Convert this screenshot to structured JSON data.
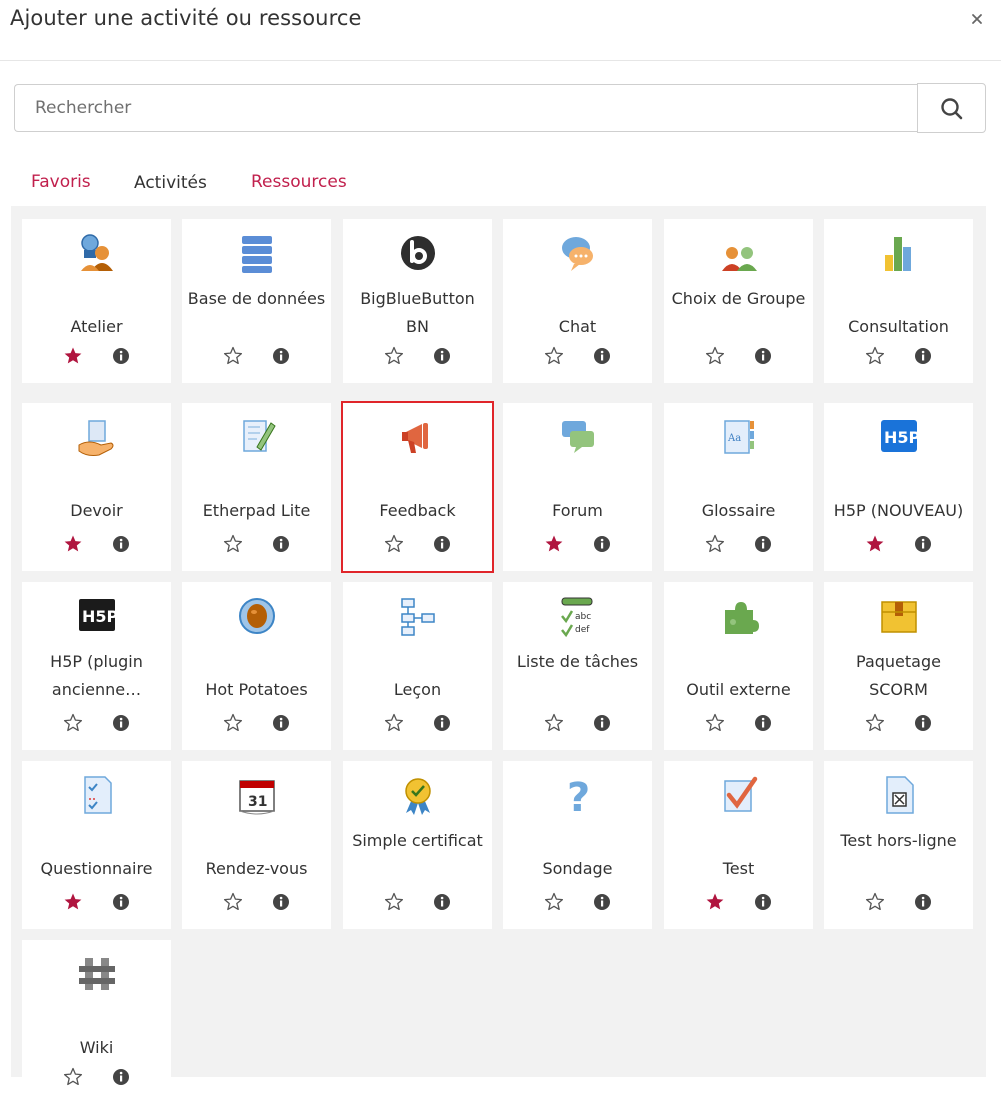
{
  "header": {
    "title": "Ajouter une activité ou ressource",
    "close_label": "×"
  },
  "search": {
    "placeholder": "Rechercher",
    "value": ""
  },
  "tabs": [
    {
      "label": "Favoris",
      "active": false
    },
    {
      "label": "Activités",
      "active": true
    },
    {
      "label": "Ressources",
      "active": false
    }
  ],
  "colors": {
    "accent": "#c1204d",
    "star_active": "#b0153f",
    "highlight_border": "#e0252a",
    "panel_bg": "#f2f2f2"
  },
  "activities": [
    {
      "name": "Atelier",
      "icon": "workshop-people-icon",
      "favorite": true
    },
    {
      "name": "Base de données",
      "icon": "database-icon",
      "favorite": false
    },
    {
      "name": "BigBlueButton BN",
      "icon": "bigbluebutton-icon",
      "favorite": false
    },
    {
      "name": "Chat",
      "icon": "chat-bubble-icon",
      "favorite": false
    },
    {
      "name": "Choix de Groupe",
      "icon": "group-choice-icon",
      "favorite": false
    },
    {
      "name": "Consultation",
      "icon": "bar-chart-icon",
      "favorite": false
    },
    {
      "name": "Devoir",
      "icon": "assignment-hand-icon",
      "favorite": true
    },
    {
      "name": "Etherpad Lite",
      "icon": "etherpad-pencil-icon",
      "favorite": false
    },
    {
      "name": "Feedback",
      "icon": "megaphone-icon",
      "favorite": false
    },
    {
      "name": "Forum",
      "icon": "forum-bubbles-icon",
      "favorite": true
    },
    {
      "name": "Glossaire",
      "icon": "glossary-book-icon",
      "favorite": false
    },
    {
      "name": "H5P (NOUVEAU)",
      "icon": "h5p-blue-icon",
      "favorite": true
    },
    {
      "name": "H5P (plugin ancienne…",
      "icon": "h5p-black-icon",
      "favorite": false
    },
    {
      "name": "Hot Potatoes",
      "icon": "hot-potatoes-icon",
      "favorite": false
    },
    {
      "name": "Leçon",
      "icon": "lesson-tree-icon",
      "favorite": false
    },
    {
      "name": "Liste de tâches",
      "icon": "checklist-icon",
      "favorite": false
    },
    {
      "name": "Outil externe",
      "icon": "puzzle-piece-icon",
      "favorite": false
    },
    {
      "name": "Paquetage SCORM",
      "icon": "scorm-package-icon",
      "favorite": false
    },
    {
      "name": "Questionnaire",
      "icon": "questionnaire-icon",
      "favorite": true
    },
    {
      "name": "Rendez-vous",
      "icon": "calendar-icon",
      "favorite": false
    },
    {
      "name": "Simple certificat",
      "icon": "certificate-ribbon-icon",
      "favorite": false
    },
    {
      "name": "Sondage",
      "icon": "question-mark-icon",
      "favorite": false
    },
    {
      "name": "Test",
      "icon": "test-checkmark-icon",
      "favorite": true
    },
    {
      "name": "Test hors-ligne",
      "icon": "offline-test-icon",
      "favorite": false
    },
    {
      "name": "Wiki",
      "icon": "wiki-icon",
      "favorite": false
    }
  ],
  "highlighted": "Feedback"
}
